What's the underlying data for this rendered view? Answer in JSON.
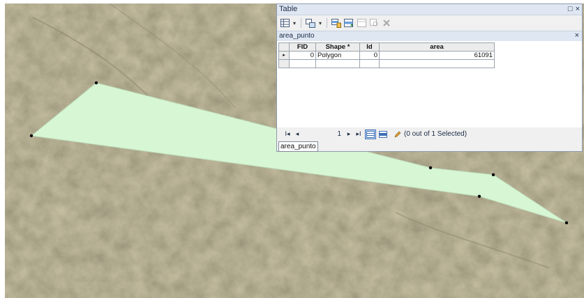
{
  "window": {
    "title": "Table",
    "restore_glyph": "□",
    "close_glyph": "×"
  },
  "toolbar": {
    "icons": [
      "table-options-icon",
      "related-tables-icon",
      "select-by-attributes-icon",
      "switch-selection-icon",
      "clear-selection-icon",
      "zoom-to-selected-icon",
      "delete-selected-icon"
    ],
    "dropdown_glyph": "▾"
  },
  "table_tab": {
    "name": "area_punto",
    "close_glyph": "×"
  },
  "grid": {
    "columns": [
      "FID",
      "Shape *",
      "Id",
      "area"
    ],
    "rows": [
      {
        "fid": "0",
        "shape": "Polygon",
        "id": "0",
        "area": "61091"
      }
    ],
    "current_row_glyph": "▸"
  },
  "navigator": {
    "first_glyph": "I◂",
    "prev_glyph": "◂",
    "current_record": "1",
    "next_glyph": "▸",
    "last_glyph": "▸I",
    "selection_status": "(0 out of 1 Selected)"
  },
  "bottom_tab": {
    "label": "area_punto"
  },
  "colors": {
    "polygon_fill": "#d7f6d3",
    "polygon_stroke": "#bcd9b8",
    "vertex": "#000000"
  }
}
